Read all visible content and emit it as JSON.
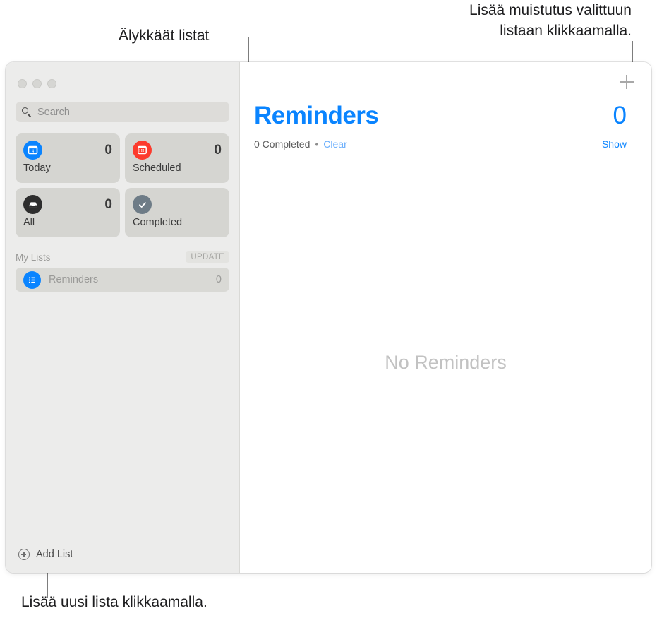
{
  "annotations": {
    "smart_lists": "Älykkäät listat",
    "add_reminder": "Lisää muistutus valittuun\nlistaan klikkaamalla.",
    "add_list": "Lisää uusi lista klikkaamalla."
  },
  "colors": {
    "accent": "#0a84ff",
    "today_icon": "#0a84ff",
    "scheduled_icon": "#fc3b2d",
    "all_icon": "#2e2e2e",
    "completed_icon": "#6e7c87",
    "list_icon": "#0a84ff",
    "sidebar_bg": "#ececeb",
    "card_bg": "#d5d5d1"
  },
  "sidebar": {
    "search": {
      "placeholder": "Search",
      "value": "",
      "icon": "search-icon"
    },
    "smart_lists": [
      {
        "label": "Today",
        "count": "0",
        "icon": "today-calendar-icon",
        "icon_text": "4"
      },
      {
        "label": "Scheduled",
        "count": "0",
        "icon": "scheduled-calendar-icon",
        "icon_text": ""
      },
      {
        "label": "All",
        "count": "0",
        "icon": "all-inbox-icon",
        "icon_text": ""
      },
      {
        "label": "Completed",
        "count": "",
        "icon": "completed-check-icon",
        "icon_text": ""
      }
    ],
    "my_lists": {
      "title": "My Lists",
      "badge": "UPDATE",
      "items": [
        {
          "label": "Reminders",
          "count": "0",
          "icon": "list-bullet-icon"
        }
      ]
    },
    "footer": {
      "add_list_label": "Add List",
      "add_list_icon": "plus-circle-icon"
    }
  },
  "content": {
    "add_button_icon": "plus-icon",
    "title": "Reminders",
    "count": "0",
    "completed_text": "0 Completed",
    "separator": "•",
    "clear_label": "Clear",
    "show_label": "Show",
    "empty_state": "No Reminders"
  }
}
